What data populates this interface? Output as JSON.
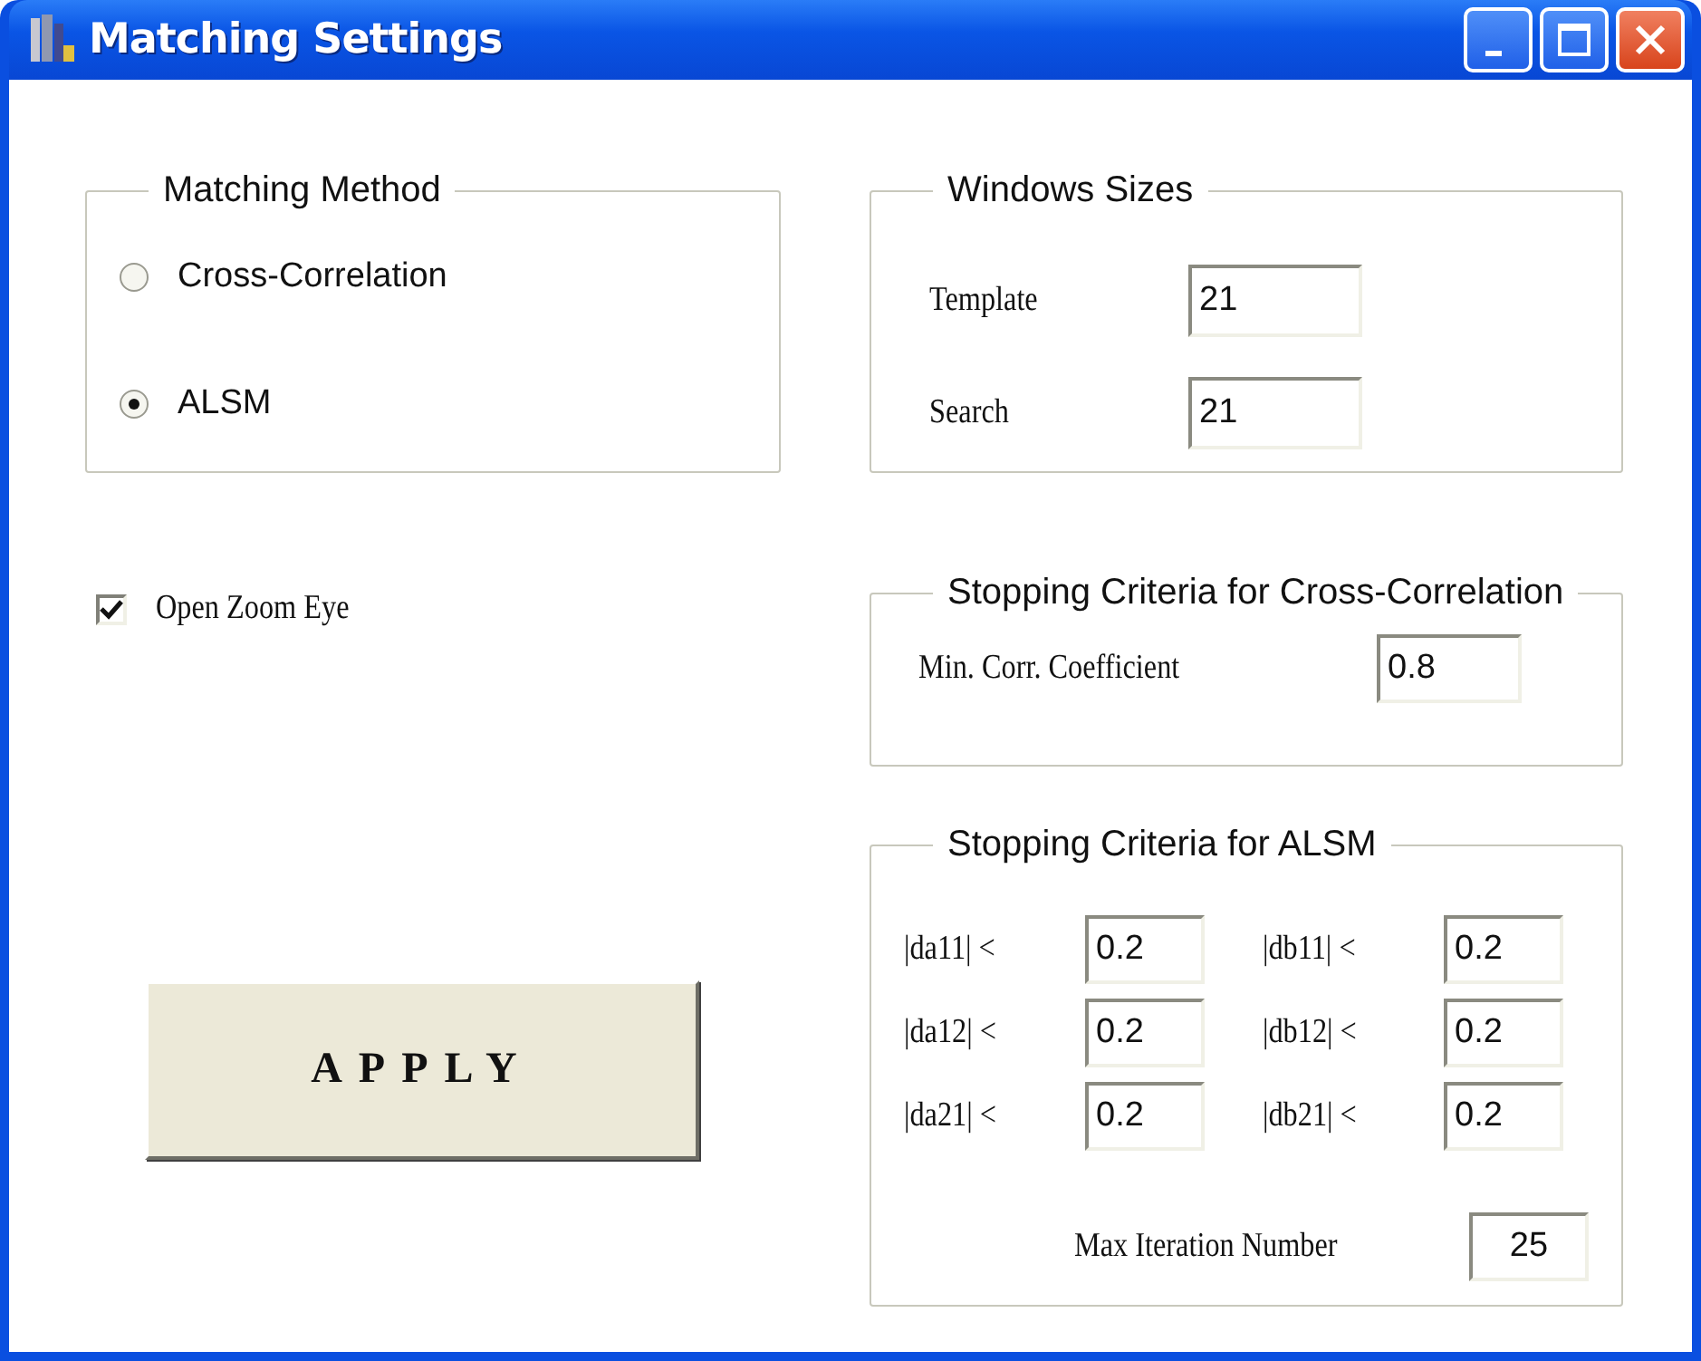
{
  "window": {
    "title": "Matching Settings"
  },
  "matching_method": {
    "title": "Matching Method",
    "options": [
      {
        "label": "Cross-Correlation",
        "selected": false
      },
      {
        "label": "ALSM",
        "selected": true
      }
    ]
  },
  "zoom_eye": {
    "label": "Open Zoom Eye",
    "checked": true
  },
  "apply_button": {
    "label": "APPLY"
  },
  "window_sizes": {
    "title": "Windows Sizes",
    "fields": [
      {
        "label": "Template",
        "value": "21"
      },
      {
        "label": "Search",
        "value": "21"
      }
    ]
  },
  "cross_correlation": {
    "title": "Stopping Criteria for Cross-Correlation",
    "fields": [
      {
        "label": "Min. Corr. Coefficient",
        "value": "0.8"
      }
    ]
  },
  "alsm": {
    "title": "Stopping Criteria for ALSM",
    "fields": [
      {
        "label": "|da11| <",
        "value": "0.2"
      },
      {
        "label": "|db11| <",
        "value": "0.2"
      },
      {
        "label": "|da12| <",
        "value": "0.2"
      },
      {
        "label": "|db12| <",
        "value": "0.2"
      },
      {
        "label": "|da21| <",
        "value": "0.2"
      },
      {
        "label": "|db21| <",
        "value": "0.2"
      }
    ],
    "max_iteration": {
      "label": "Max Iteration Number",
      "value": "25"
    }
  }
}
